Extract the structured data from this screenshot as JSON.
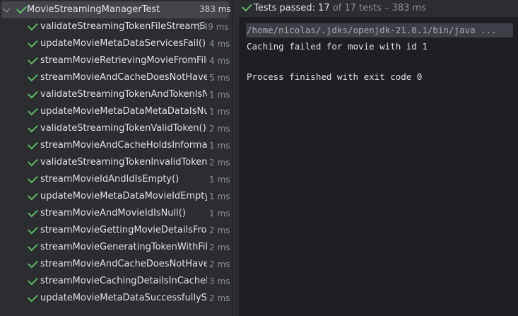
{
  "tree": {
    "root": {
      "label": "MovieStreamingManagerTest",
      "time": "383 ms"
    },
    "tests": [
      {
        "label": "validateStreamingTokenFileStreamS",
        "time": "349 ms"
      },
      {
        "label": "updateMovieMetaDataServicesFail()",
        "time": "4 ms"
      },
      {
        "label": "streamMovieRetrievingMovieFromFile",
        "time": "4 ms"
      },
      {
        "label": "streamMovieAndCacheDoesNotHaveI",
        "time": "5 ms"
      },
      {
        "label": "validateStreamingTokenAndTokenIsNu",
        "time": "1 ms"
      },
      {
        "label": "updateMovieMetaDataMetaDataIsNull",
        "time": "1 ms"
      },
      {
        "label": "validateStreamingTokenValidToken()",
        "time": "2 ms"
      },
      {
        "label": "streamMovieAndCacheHoldsInformati",
        "time": "1 ms"
      },
      {
        "label": "validateStreamingTokenInvalidToken()",
        "time": "2 ms"
      },
      {
        "label": "streamMovieIdAndIdIsEmpty()",
        "time": "1 ms"
      },
      {
        "label": "updateMovieMetaDataMovieIdEmptyC",
        "time": "1 ms"
      },
      {
        "label": "streamMovieAndMovieIdIsNull()",
        "time": "1 ms"
      },
      {
        "label": "streamMovieGettingMovieDetailsFrom",
        "time": "2 ms"
      },
      {
        "label": "streamMovieGeneratingTokenWithFile",
        "time": "2 ms"
      },
      {
        "label": "streamMovieAndCacheDoesNotHaveI",
        "time": "2 ms"
      },
      {
        "label": "streamMovieCachingDetailsInCacheFa",
        "time": "3 ms"
      },
      {
        "label": "updateMovieMetaDataSuccessfullySe",
        "time": "2 ms"
      }
    ]
  },
  "status": {
    "label": "Tests passed:",
    "passed": "17",
    "rest": "of 17 tests – 383 ms"
  },
  "console": {
    "command": "/home/nicolas/.jdks/openjdk-21.0.1/bin/java ...",
    "line1": "Caching failed for movie with id 1",
    "line2": "Process finished with exit code 0"
  },
  "colors": {
    "pass_green": "#5fb865",
    "panel_bg": "#2b2d30",
    "console_bg": "#1e1f22"
  }
}
